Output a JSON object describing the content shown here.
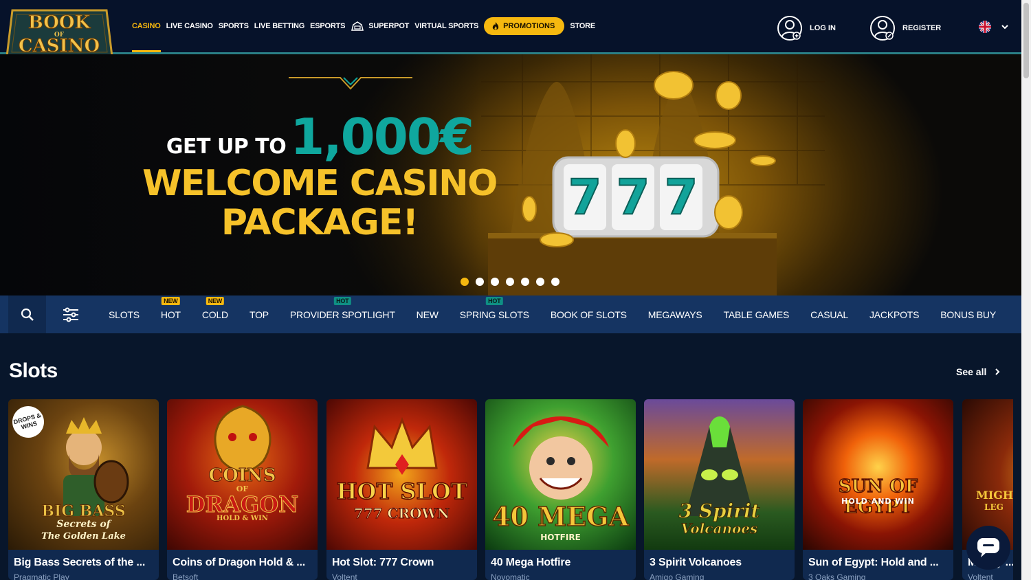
{
  "header": {
    "logo_text": "BOOK OF CASINO",
    "nav": [
      {
        "label": "CASINO",
        "active": true
      },
      {
        "label": "LIVE CASINO"
      },
      {
        "label": "SPORTS"
      },
      {
        "label": "LIVE BETTING"
      },
      {
        "label": "ESPORTS"
      },
      {
        "label": "SUPERPOT",
        "icon": "superpot-icon"
      },
      {
        "label": "VIRTUAL SPORTS"
      }
    ],
    "promotions_label": "PROMOTIONS",
    "store_label": "STORE",
    "login_label": "LOG IN",
    "register_label": "REGISTER",
    "language": "en-gb"
  },
  "hero": {
    "get_up_to": "GET UP TO",
    "amount": "1,000€",
    "line2": "WELCOME CASINO",
    "line3": "PACKAGE!",
    "slide_count": 7,
    "active_slide": 0
  },
  "categories": {
    "items": [
      {
        "label": "SLOTS"
      },
      {
        "label": "HOT",
        "badge": "NEW"
      },
      {
        "label": "COLD",
        "badge": "NEW"
      },
      {
        "label": "TOP"
      },
      {
        "label": "PROVIDER SPOTLIGHT",
        "badge": "HOT"
      },
      {
        "label": "NEW"
      },
      {
        "label": "SPRING SLOTS",
        "badge": "HOT"
      },
      {
        "label": "BOOK OF SLOTS"
      },
      {
        "label": "MEGAWAYS"
      },
      {
        "label": "TABLE GAMES"
      },
      {
        "label": "CASUAL"
      },
      {
        "label": "JACKPOTS"
      },
      {
        "label": "BONUS BUY"
      }
    ]
  },
  "slots": {
    "title": "Slots",
    "see_all": "See all",
    "games": [
      {
        "title": "Big Bass Secrets of the ...",
        "provider": "Pragmatic Play",
        "art": [
          "BIG BASS",
          "Secrets of",
          "The Golden Lake"
        ],
        "badge": "DROPS & WINS"
      },
      {
        "title": "Coins of Dragon Hold & ...",
        "provider": "Betsoft",
        "art": [
          "COINS",
          "OF",
          "DRAGON",
          "HOLD & WIN"
        ]
      },
      {
        "title": "Hot Slot: 777 Crown",
        "provider": "Voltent",
        "art": [
          "HOT SLOT",
          "777 CROWN"
        ]
      },
      {
        "title": "40 Mega Hotfire",
        "provider": "Novomatic",
        "art": [
          "40 MEGA",
          "HOTFIRE"
        ]
      },
      {
        "title": "3 Spirit Volcanoes",
        "provider": "Amigo Gaming",
        "art": [
          "3 Spirit",
          "Volcanoes"
        ]
      },
      {
        "title": "Sun of Egypt: Hold and ...",
        "provider": "3 Oaks Gaming",
        "art": [
          "SUN OF EGYPT",
          "HOLD AND WIN"
        ]
      },
      {
        "title": "Mighty ...",
        "provider": "Voltent",
        "art": [
          "MIGH",
          "LEG"
        ]
      }
    ]
  },
  "colors": {
    "accent": "#f6b80f",
    "teal": "#0fa79e",
    "header_bg": "#06122a",
    "page_bg": "#08162b",
    "catbar_bg": "#153462"
  }
}
